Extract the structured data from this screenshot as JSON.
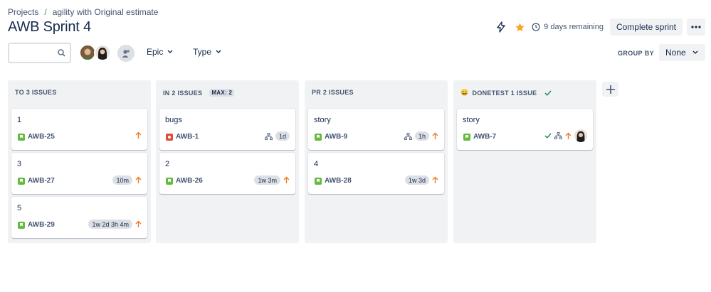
{
  "breadcrumb": {
    "project": "Projects",
    "separator": "/",
    "board": "agility with Original estimate"
  },
  "header": {
    "title": "AWB Sprint 4",
    "remaining": "9 days remaining",
    "complete_label": "Complete sprint",
    "star_color": "#f5a623",
    "more_icon": "more-icon"
  },
  "toolbar": {
    "search_value": "",
    "search_placeholder": "",
    "epic_label": "Epic",
    "type_label": "Type",
    "group_by_label": "GROUP BY",
    "group_by_value": "None"
  },
  "columns": [
    {
      "title": "TO 3 ISSUES",
      "cards": [
        {
          "title": "1",
          "key": "AWB-25",
          "type": "story",
          "estimate": ""
        },
        {
          "title": "3",
          "key": "AWB-27",
          "type": "story",
          "estimate": "10m"
        },
        {
          "title": "5",
          "key": "AWB-29",
          "type": "story",
          "estimate": "1w 2d 3h 4m"
        }
      ]
    },
    {
      "title": "IN 2 ISSUES",
      "max": "MAX: 2",
      "cards": [
        {
          "title": "bugs",
          "key": "AWB-1",
          "type": "bug",
          "estimate": "1d"
        },
        {
          "title": "2",
          "key": "AWB-26",
          "type": "story",
          "estimate": "1w 3m"
        }
      ]
    },
    {
      "title": "PR 2 ISSUES",
      "cards": [
        {
          "title": "story",
          "key": "AWB-9",
          "type": "story",
          "estimate": "1h"
        },
        {
          "title": "4",
          "key": "AWB-28",
          "type": "story",
          "estimate": "1w 3d"
        }
      ]
    },
    {
      "title": "DONETEST 1 ISSUE",
      "emoji": "😀",
      "cards": [
        {
          "title": "story",
          "key": "AWB-7",
          "type": "story",
          "estimate": ""
        }
      ]
    }
  ],
  "colors": {
    "priority": "#f07a28",
    "done_check": "#1f845a",
    "column_bg": "#f1f2f4"
  }
}
